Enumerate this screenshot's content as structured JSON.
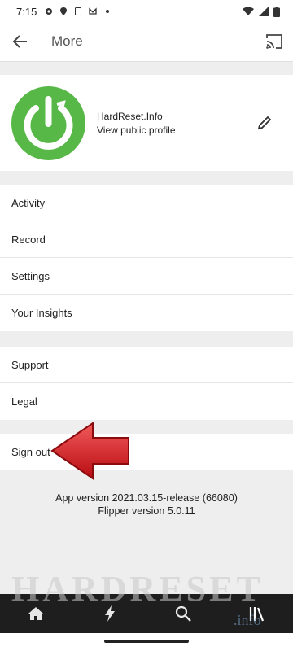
{
  "status_bar": {
    "time": "7:15"
  },
  "app_bar": {
    "title": "More"
  },
  "profile": {
    "name": "HardReset.Info",
    "link": "View public profile"
  },
  "menu_group_1": [
    "Activity",
    "Record",
    "Settings",
    "Your Insights"
  ],
  "menu_group_2": [
    "Support",
    "Legal"
  ],
  "menu_group_3": [
    "Sign out"
  ],
  "version": {
    "app": "App version 2021.03.15-release (66080)",
    "flipper": "Flipper version 5.0.11"
  },
  "watermark": {
    "text": "HARDRESET",
    "suffix": ".info"
  },
  "bottom_nav": [
    "home-icon",
    "bolt-icon",
    "search-icon",
    "library-icon"
  ],
  "colors": {
    "avatar": "#58b847",
    "arrow": "#d8141c",
    "nav_bg": "#1e1e1e"
  }
}
